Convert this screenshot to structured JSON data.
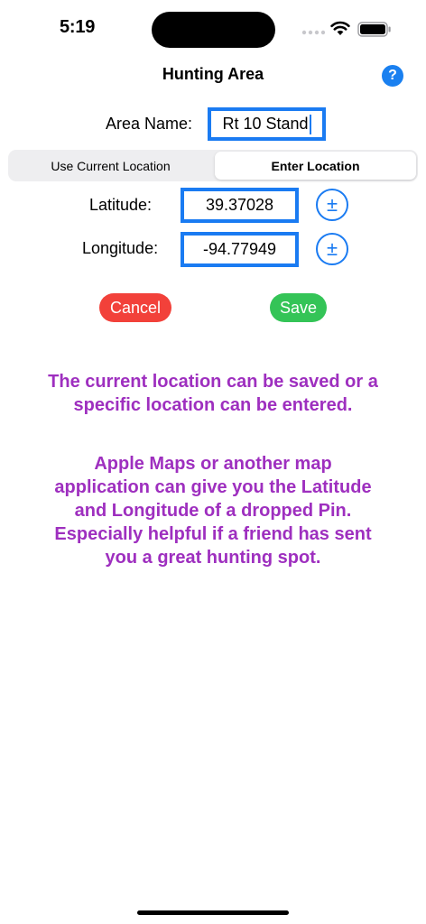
{
  "status_bar": {
    "time": "5:19"
  },
  "nav": {
    "title": "Hunting Area",
    "help_label": "?"
  },
  "form": {
    "area_name_label": "Area Name:",
    "area_name_value": "Rt 10 Stand",
    "latitude_label": "Latitude:",
    "latitude_value": "39.37028",
    "longitude_label": "Longitude:",
    "longitude_value": "-94.77949",
    "plus_minus_glyph": "±"
  },
  "segmented": {
    "options": [
      "Use Current Location",
      "Enter Location"
    ],
    "selected": "Enter Location"
  },
  "actions": {
    "cancel_label": "Cancel",
    "save_label": "Save"
  },
  "info": {
    "paragraph_1": "The current location can be saved or a specific location can be entered.",
    "paragraph_2": "Apple Maps or another map application can give you the Latitude and Longitude of a dropped Pin. Especially helpful if a friend has sent you a great hunting spot."
  },
  "colors": {
    "accent": "#1a7bf2",
    "cancel": "#f2413a",
    "save": "#34c457",
    "info_text": "#9e2fbf"
  },
  "icons": {
    "help": "question-mark-circle",
    "plus_minus": "plus-minus-circle",
    "signal": "cellular-signal",
    "wifi": "wifi",
    "battery": "battery"
  }
}
